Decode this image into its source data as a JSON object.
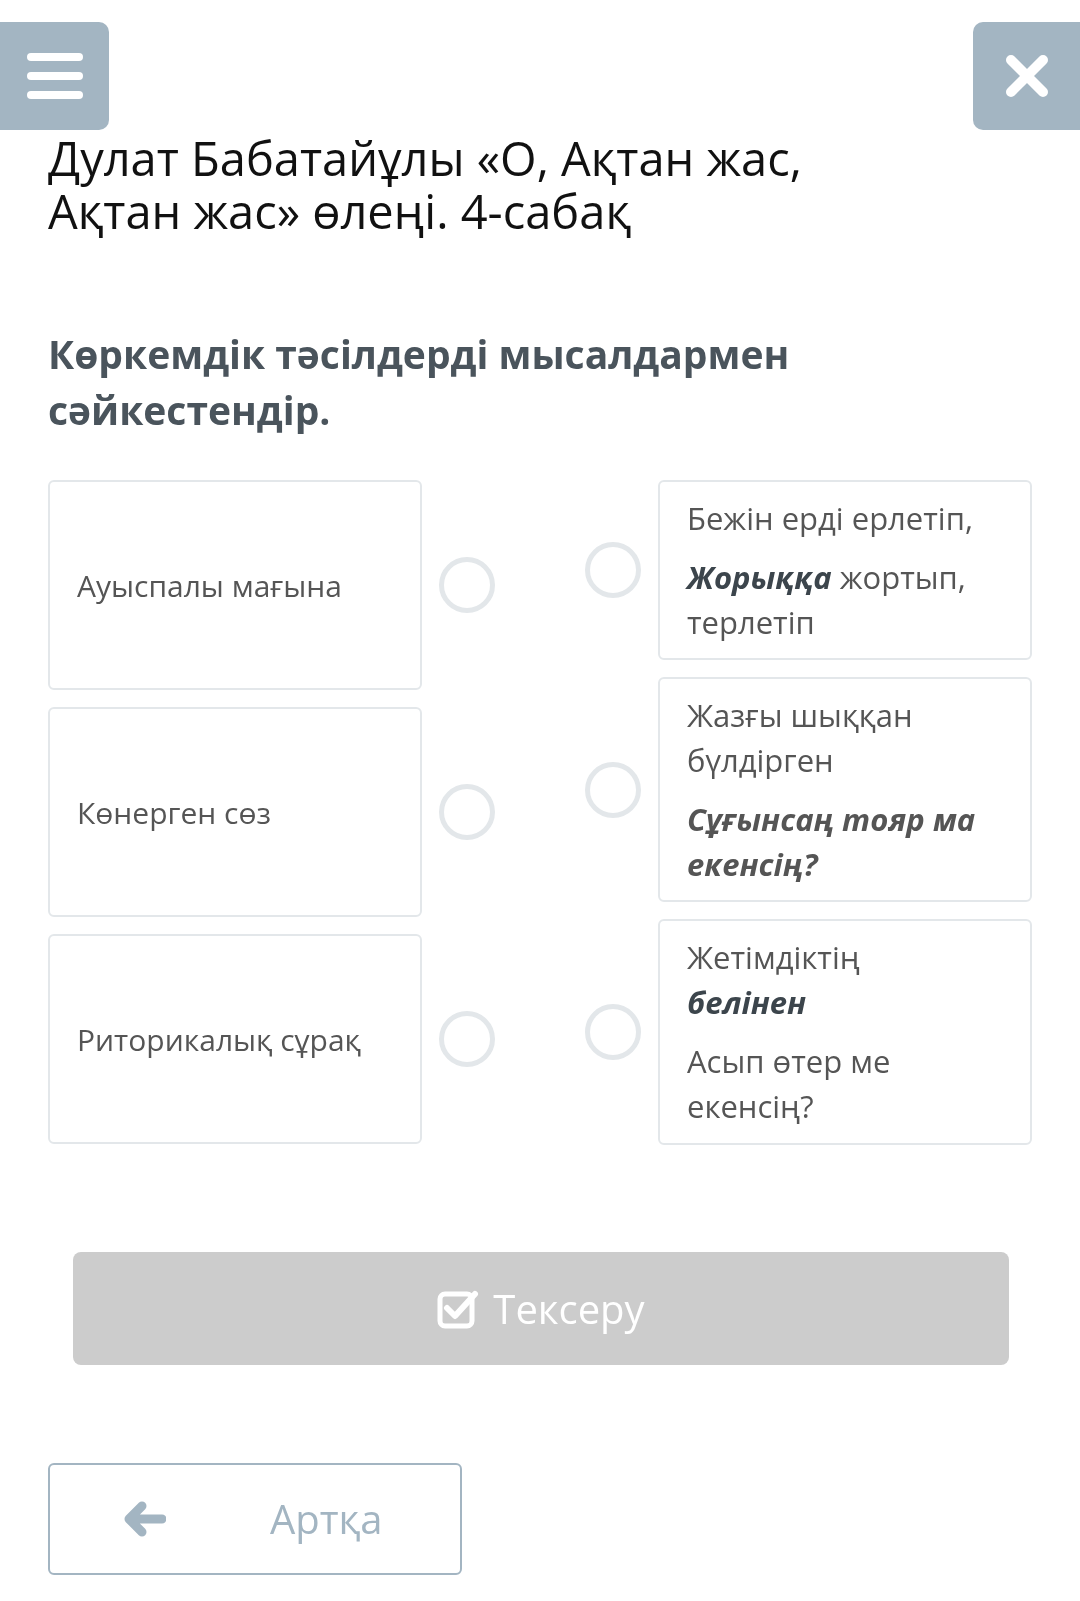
{
  "title": "Дулат Бабатайұлы «О, Ақтан жас, Ақтан жас» өлеңі. 4-сабақ",
  "question": "Көркемдік тәсілдерді мысалдармен сәйкестендір.",
  "left_items": [
    {
      "text": "Ауыспалы мағына",
      "selected": false
    },
    {
      "text": "Көнерген сөз",
      "selected": false
    },
    {
      "text": "Риторикалық сұрақ",
      "selected": false
    }
  ],
  "right_items": [
    {
      "selected": false,
      "paragraphs": [
        {
          "text": "Бежін ерді ерлетіп,",
          "emphasis": false
        },
        {
          "text": "**Жорыққа** жортып, терлетіп",
          "emphasis": false
        }
      ]
    },
    {
      "selected": false,
      "paragraphs": [
        {
          "text": "Жазғы шыққан бүлдірген",
          "emphasis": false
        },
        {
          "text": "Сұғынсаң тояр ма екенсің?",
          "emphasis": true
        }
      ]
    },
    {
      "selected": false,
      "paragraphs": [
        {
          "text": "Жетімдіктің **белінен**",
          "emphasis": false
        },
        {
          "text": "Асып өтер ме екенсің?",
          "emphasis": false
        }
      ]
    }
  ],
  "check_button": {
    "label": "Тексеру",
    "disabled": true
  },
  "back_button": {
    "label": "Артқа"
  }
}
